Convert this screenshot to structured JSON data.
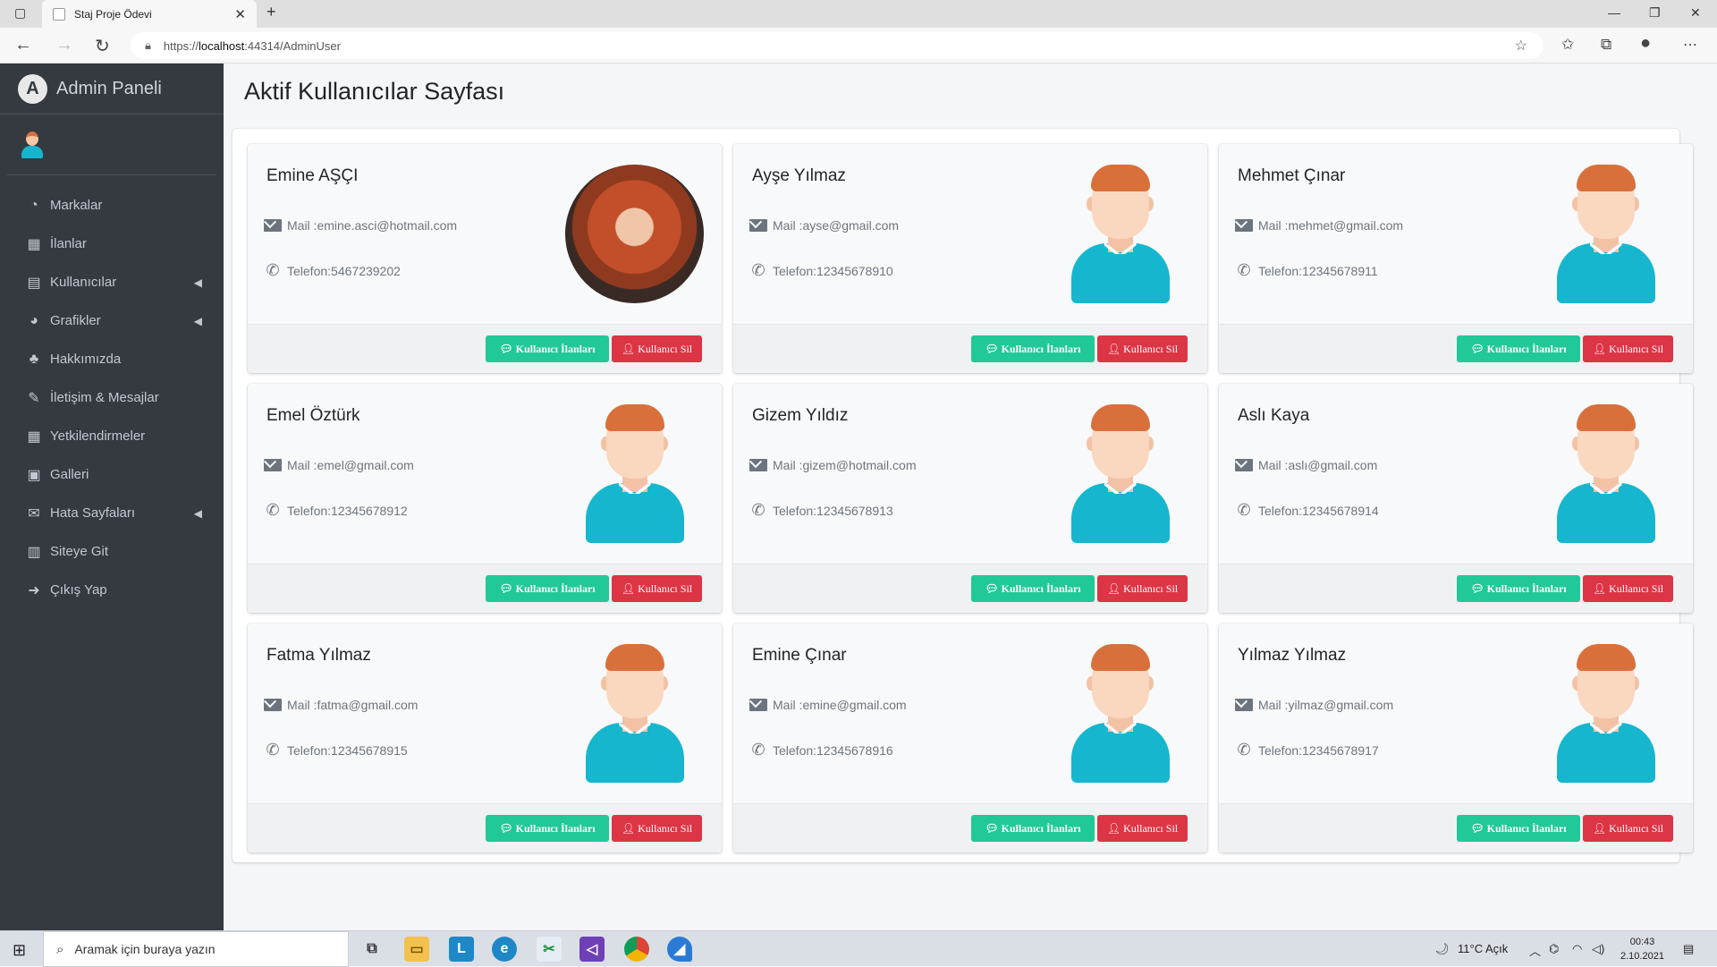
{
  "browser": {
    "tab_title": "Staj Proje Ödevi",
    "url_prefix": "https://",
    "url_host": "localhost",
    "url_rest": ":44314/AdminUser"
  },
  "sidebar": {
    "brand": "Admin Paneli",
    "items": [
      {
        "label": "Markalar",
        "icon": "tachometer-icon"
      },
      {
        "label": "İlanlar",
        "icon": "grid-icon"
      },
      {
        "label": "Kullanıcılar",
        "icon": "copy-icon",
        "has_arrow": true
      },
      {
        "label": "Grafikler",
        "icon": "pie-chart-icon",
        "has_arrow": true
      },
      {
        "label": "Hakkımızda",
        "icon": "tree-icon"
      },
      {
        "label": "İletişim & Mesajlar",
        "icon": "edit-icon"
      },
      {
        "label": "Yetkilendirmeler",
        "icon": "calendar-icon"
      },
      {
        "label": "Galleri",
        "icon": "image-icon"
      },
      {
        "label": "Hata Sayfaları",
        "icon": "envelope-icon",
        "has_arrow": true
      },
      {
        "label": "Siteye Git",
        "icon": "book-icon"
      },
      {
        "label": "Çıkış Yap",
        "icon": "sign-out-icon"
      }
    ]
  },
  "page": {
    "title": "Aktif Kullanıcılar Sayfası",
    "mail_prefix": "Mail : ",
    "phone_prefix": "Telefon: ",
    "btn_ilan": "Kullanıcı İlanları",
    "btn_sil": "Kullanıcı Sil"
  },
  "users": [
    {
      "name": "Emine AŞÇI",
      "mail": "emine.asci@hotmail.com",
      "phone": "5467239202",
      "photo": true
    },
    {
      "name": "Ayşe Yılmaz",
      "mail": "ayse@gmail.com",
      "phone": "12345678910"
    },
    {
      "name": "Mehmet Çınar",
      "mail": "mehmet@gmail.com",
      "phone": "12345678911"
    },
    {
      "name": "Emel Öztürk",
      "mail": "emel@gmail.com",
      "phone": "12345678912"
    },
    {
      "name": "Gizem Yıldız",
      "mail": "gizem@hotmail.com",
      "phone": "12345678913"
    },
    {
      "name": "Aslı Kaya",
      "mail": "aslı@gmail.com",
      "phone": "12345678914"
    },
    {
      "name": "Fatma Yılmaz",
      "mail": "fatma@gmail.com",
      "phone": "12345678915"
    },
    {
      "name": "Emine Çınar",
      "mail": "emine@gmail.com",
      "phone": "12345678916"
    },
    {
      "name": "Yılmaz Yılmaz",
      "mail": "yilmaz@gmail.com",
      "phone": "12345678917"
    }
  ],
  "taskbar": {
    "search_placeholder": "Aramak için buraya yazın",
    "weather": "11°C  Açık",
    "time": "00:43",
    "date": "2.10.2021"
  },
  "colors": {
    "sidebar_bg": "#343a40",
    "btn_ilan": "#20c997",
    "btn_sil": "#dc3545",
    "shirt": "#16b6cf"
  }
}
